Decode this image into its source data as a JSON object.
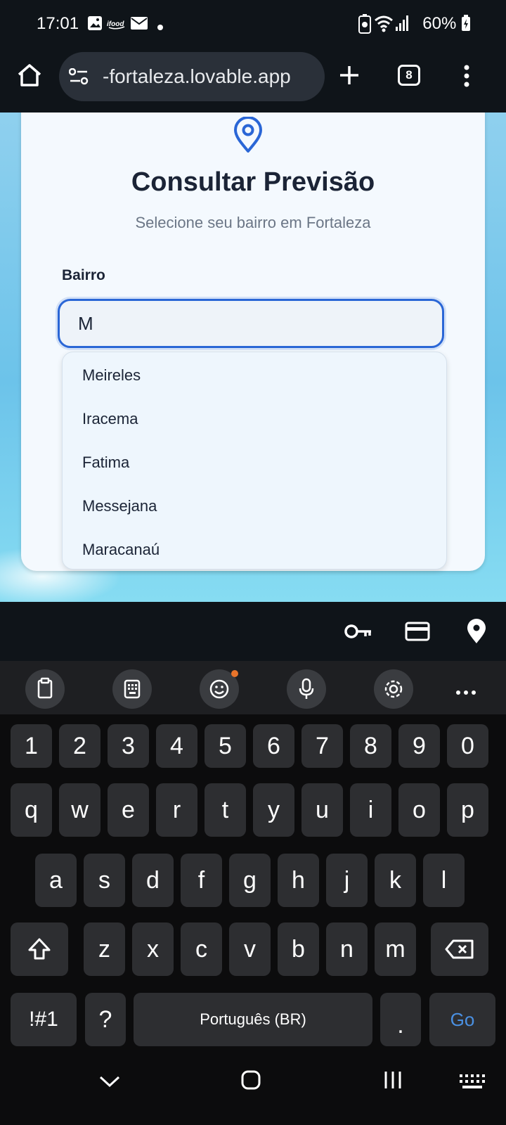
{
  "status_bar": {
    "time": "17:01",
    "battery": "60%"
  },
  "browser": {
    "url": "-fortaleza.lovable.app",
    "tab_count": "8"
  },
  "card": {
    "title": "Consultar Previsão",
    "subtitle": "Selecione seu bairro em Fortaleza",
    "field_label": "Bairro",
    "input_value": "M",
    "suggestions": [
      "Meireles",
      "Iracema",
      "Fatima",
      "Messejana",
      "Maracanaú"
    ]
  },
  "keyboard": {
    "row_numbers": [
      "1",
      "2",
      "3",
      "4",
      "5",
      "6",
      "7",
      "8",
      "9",
      "0"
    ],
    "row_top": [
      "q",
      "w",
      "e",
      "r",
      "t",
      "y",
      "u",
      "i",
      "o",
      "p"
    ],
    "row_mid": [
      "a",
      "s",
      "d",
      "f",
      "g",
      "h",
      "j",
      "k",
      "l"
    ],
    "row_bottom": [
      "z",
      "x",
      "c",
      "v",
      "b",
      "n",
      "m"
    ],
    "symbols_key": "!#1",
    "question_key": "?",
    "space_label": "Português (BR)",
    "period_key": ".",
    "go_key": "Go"
  },
  "colors": {
    "accent": "#2a66d6",
    "go": "#4a90e2"
  }
}
